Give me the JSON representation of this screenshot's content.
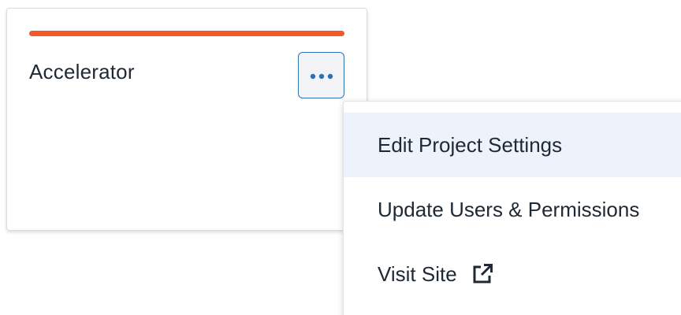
{
  "card": {
    "title": "Accelerator",
    "accent_color": "#f05a28",
    "more_button_icon": "more-horizontal-icon"
  },
  "menu": {
    "items": [
      {
        "label": "Edit Project Settings",
        "highlighted": true
      },
      {
        "label": "Update Users & Permissions",
        "highlighted": false
      },
      {
        "label": "Visit Site",
        "icon": "external-link-icon",
        "highlighted": false
      }
    ]
  }
}
